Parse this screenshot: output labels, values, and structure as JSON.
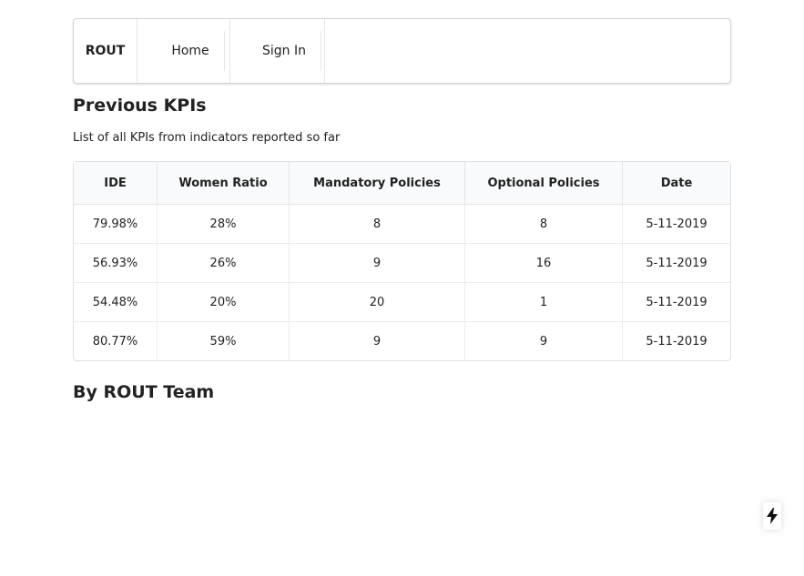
{
  "nav": {
    "brand": "ROUT",
    "home": "Home",
    "sign_in": "Sign In"
  },
  "page": {
    "title": "Previous KPIs",
    "subtitle": "List of all KPIs from indicators reported so far",
    "footer": "By ROUT Team"
  },
  "table": {
    "headers": [
      "IDE",
      "Women Ratio",
      "Mandatory Policies",
      "Optional Policies",
      "Date"
    ],
    "rows": [
      [
        "79.98%",
        "28%",
        "8",
        "8",
        "5-11-2019"
      ],
      [
        "56.93%",
        "26%",
        "9",
        "16",
        "5-11-2019"
      ],
      [
        "54.48%",
        "20%",
        "20",
        "1",
        "5-11-2019"
      ],
      [
        "80.77%",
        "59%",
        "9",
        "9",
        "5-11-2019"
      ]
    ]
  },
  "icons": {
    "fab": "lightning-bolt-icon"
  }
}
